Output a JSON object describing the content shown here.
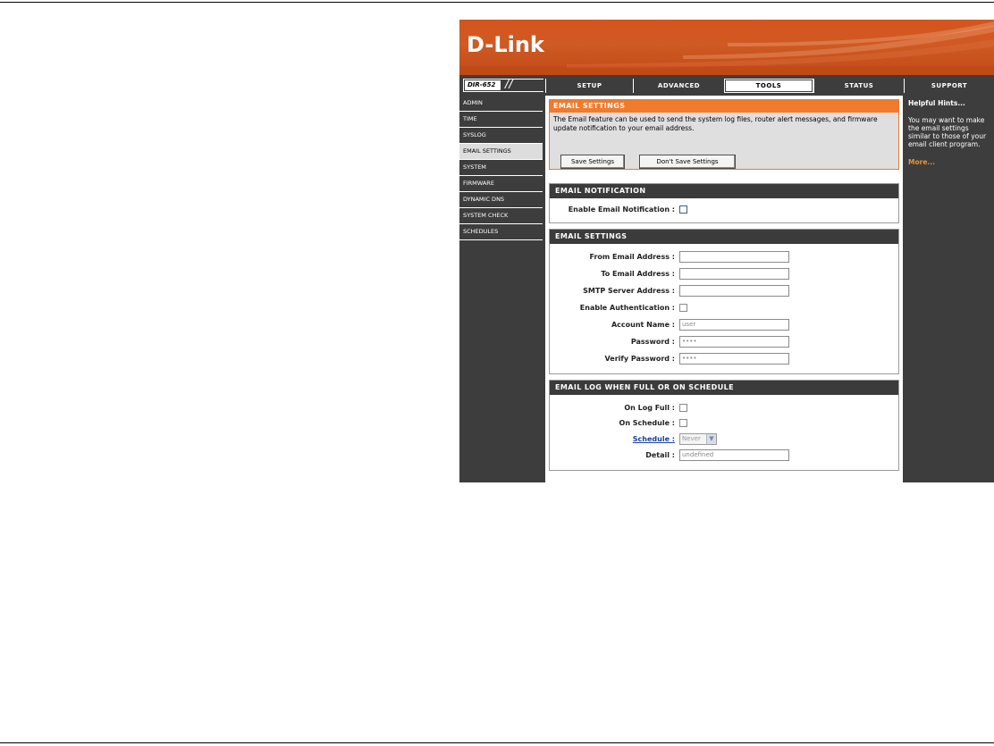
{
  "brand": {
    "logo": "D-Link",
    "model": "DIR-652"
  },
  "nav": {
    "tabs": [
      {
        "label": "SETUP"
      },
      {
        "label": "ADVANCED"
      },
      {
        "label": "TOOLS",
        "active": true
      },
      {
        "label": "STATUS"
      },
      {
        "label": "SUPPORT"
      }
    ]
  },
  "sidebar": {
    "items": [
      {
        "label": "ADMIN"
      },
      {
        "label": "TIME"
      },
      {
        "label": "SYSLOG"
      },
      {
        "label": "EMAIL SETTINGS",
        "active": true
      },
      {
        "label": "SYSTEM"
      },
      {
        "label": "FIRMWARE"
      },
      {
        "label": "DYNAMIC DNS"
      },
      {
        "label": "SYSTEM CHECK"
      },
      {
        "label": "SCHEDULES"
      }
    ]
  },
  "intro": {
    "title": "EMAIL SETTINGS",
    "description": "The Email feature can be used to send the system log files, router alert messages, and firmware update notification to your email address.",
    "save_label": "Save Settings",
    "dont_save_label": "Don't Save Settings"
  },
  "notification": {
    "title": "EMAIL NOTIFICATION",
    "enable_label": "Enable Email Notification :",
    "enabled": false
  },
  "email_settings": {
    "title": "EMAIL SETTINGS",
    "from_label": "From Email Address :",
    "from_value": "",
    "to_label": "To Email Address :",
    "to_value": "",
    "smtp_label": "SMTP Server Address :",
    "smtp_value": "",
    "auth_label": "Enable Authentication :",
    "auth_enabled": false,
    "account_label": "Account Name :",
    "account_value": "user",
    "password_label": "Password :",
    "password_value": "••••",
    "verify_label": "Verify Password :",
    "verify_value": "••••"
  },
  "log_schedule": {
    "title": "EMAIL LOG WHEN FULL OR ON SCHEDULE",
    "logfull_label": "On Log Full :",
    "schedule_chk_label": "On Schedule :",
    "schedule_label": "Schedule :",
    "schedule_value": "Never",
    "detail_label": "Detail :",
    "detail_value": "undefined"
  },
  "hints": {
    "title": "Helpful Hints...",
    "text": "You may want to make the email settings similar to those of your email client program.",
    "more": "More..."
  },
  "colors": {
    "orange": "#f07b2c",
    "dark": "#3d3d3d",
    "link": "#1a3f9a",
    "more": "#e8913f"
  }
}
